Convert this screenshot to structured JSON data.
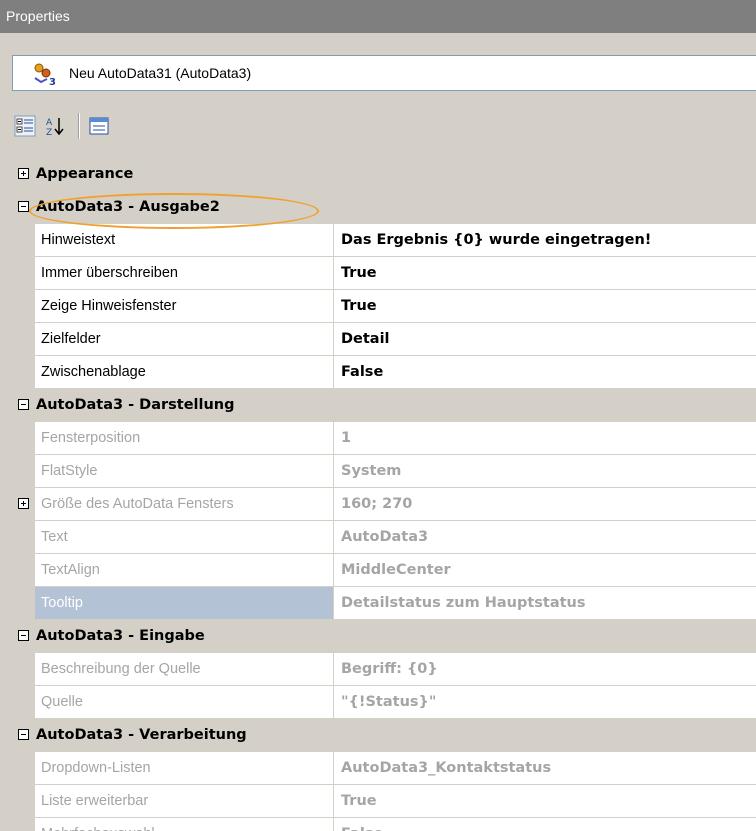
{
  "window": {
    "title": "Properties"
  },
  "object_selector": {
    "text": "Neu AutoData31 (AutoData3)",
    "icon": "autodata-object-icon"
  },
  "toolbar": {
    "buttons": [
      {
        "icon": "categorized-icon",
        "tooltip": ""
      },
      {
        "icon": "alphabetical-sort-icon",
        "tooltip": ""
      },
      {
        "icon": "property-pages-icon",
        "tooltip": ""
      }
    ]
  },
  "categories": [
    {
      "name": "Appearance",
      "expanded": false,
      "properties": []
    },
    {
      "name": "AutoData3 - Ausgabe2",
      "expanded": true,
      "properties": [
        {
          "name": "Hinweistext",
          "value": "Das Ergebnis {0} wurde eingetragen!",
          "readonly": false
        },
        {
          "name": "Immer überschreiben",
          "value": "True",
          "readonly": false
        },
        {
          "name": "Zeige Hinweisfenster",
          "value": "True",
          "readonly": false
        },
        {
          "name": "Zielfelder",
          "value": "Detail",
          "readonly": false
        },
        {
          "name": "Zwischenablage",
          "value": "False",
          "readonly": false
        }
      ]
    },
    {
      "name": "AutoData3 - Darstellung",
      "expanded": true,
      "properties": [
        {
          "name": "Fensterposition",
          "value": "1",
          "readonly": true
        },
        {
          "name": "FlatStyle",
          "value": "System",
          "readonly": true
        },
        {
          "name": "Größe des AutoData Fensters",
          "value": "160; 270",
          "readonly": true,
          "expandable": true
        },
        {
          "name": "Text",
          "value": "AutoData3",
          "readonly": true
        },
        {
          "name": "TextAlign",
          "value": "MiddleCenter",
          "readonly": true
        },
        {
          "name": "Tooltip",
          "value": "Detailstatus zum Hauptstatus",
          "readonly": true,
          "selected": true
        }
      ]
    },
    {
      "name": "AutoData3 - Eingabe",
      "expanded": true,
      "properties": [
        {
          "name": "Beschreibung der Quelle",
          "value": "Begriff: {0}",
          "readonly": true
        },
        {
          "name": "Quelle",
          "value": "\"{!Status}\"",
          "readonly": true
        }
      ]
    },
    {
      "name": "AutoData3 - Verarbeitung",
      "expanded": true,
      "properties": [
        {
          "name": "Dropdown-Listen",
          "value": "AutoData3_Kontaktstatus",
          "readonly": true
        },
        {
          "name": "Liste erweiterbar",
          "value": "True",
          "readonly": true
        },
        {
          "name": "Mehrfachauswahl",
          "value": "False",
          "readonly": true
        }
      ]
    }
  ],
  "colors": {
    "highlight_ring": "#f0a030",
    "selected_row": "#b4c2d6",
    "readonly_text": "#a5a5a5"
  }
}
